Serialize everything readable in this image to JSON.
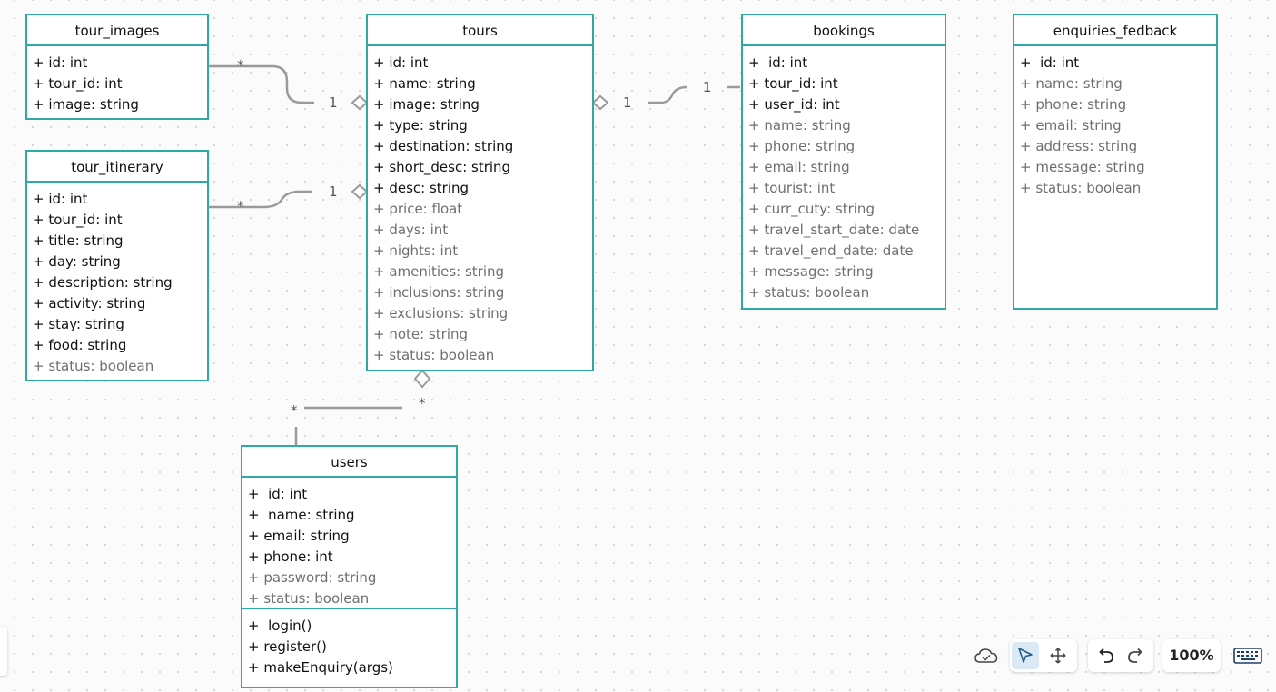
{
  "classes": {
    "tour_images": {
      "title": "tour_images",
      "attrs": [
        "+ id: int",
        "+ tour_id: int",
        "+ image: string"
      ]
    },
    "tour_itinerary": {
      "title": "tour_itinerary",
      "attrs": [
        "+ id: int",
        "+ tour_id: int",
        "+ title: string",
        "+ day: string",
        "+ description: string",
        "+ activity: string",
        "+ stay: string",
        "+ food: string",
        "+ status: boolean"
      ]
    },
    "tours": {
      "title": "tours",
      "attrs": [
        "+ id: int",
        "+ name: string",
        "+ image: string",
        "+ type: string",
        "+ destination: string",
        "+ short_desc: string",
        "+ desc: string",
        "+ price: float",
        "+ days: int",
        "+ nights: int",
        "+ amenities: string",
        "+ inclusions: string",
        "+ exclusions: string",
        "+ note: string",
        "+ status: boolean"
      ]
    },
    "bookings": {
      "title": "bookings",
      "attrs": [
        "+  id: int",
        "+ tour_id: int",
        "+ user_id: int",
        "+ name: string",
        "+ phone: string",
        "+ email: string",
        "+ tourist: int",
        "+ curr_cuty: string",
        "+ travel_start_date: date",
        "+ travel_end_date: date",
        "+ message: string",
        "+ status: boolean"
      ]
    },
    "enquiries_fedback": {
      "title": "enquiries_fedback",
      "attrs": [
        "+  id: int",
        "+ name: string",
        "+ phone: string",
        "+ email: string",
        "+ address: string",
        "+ message: string",
        "+ status: boolean"
      ]
    },
    "users": {
      "title": "users",
      "attrs": [
        "+  id: int",
        "+  name: string",
        "+ email: string",
        "+ phone: int",
        "+ password: string",
        "+ status: boolean"
      ],
      "ops": [
        "+  login()",
        "+ register()",
        "+ makeEnquiry(args)"
      ]
    }
  },
  "multiplicities": {
    "images_many": "*",
    "images_one": "1",
    "itinerary_many": "*",
    "itinerary_one": "1",
    "bookings_tours_one": "1",
    "bookings_one": "1",
    "users_many": "*",
    "tours_users_many": "*"
  },
  "toolbar": {
    "zoom": "100%",
    "icons": [
      "cloud-icon",
      "pointer-icon",
      "move-icon",
      "undo-icon",
      "redo-icon",
      "keyboard-icon"
    ]
  },
  "colors": {
    "class_border": "#2fa8a8",
    "connector": "#9a9a9a",
    "muted_text": "#6f6f6f",
    "active_tool": "#dbe9f4"
  }
}
